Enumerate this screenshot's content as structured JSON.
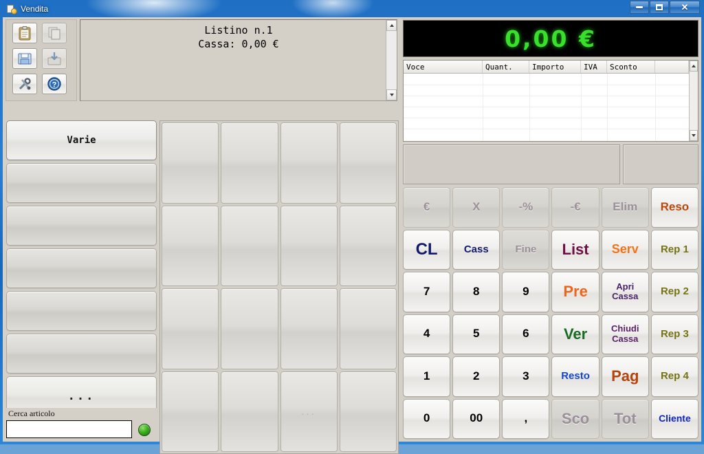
{
  "window": {
    "title": "Vendita",
    "icon": "app-page-coin-icon",
    "controls": {
      "minimize": "–",
      "maximize": "❑",
      "close": "✕"
    }
  },
  "toolbar": {
    "buttons": [
      {
        "name": "clipboard",
        "icon": "clipboard-icon",
        "enabled": true
      },
      {
        "name": "copy",
        "icon": "copy-documents-icon",
        "enabled": false
      },
      {
        "name": "save",
        "icon": "save-disk-icon",
        "enabled": true
      },
      {
        "name": "load",
        "icon": "load-import-icon",
        "enabled": false
      },
      {
        "name": "tools",
        "icon": "tools-wrench-screwdriver-icon",
        "enabled": true
      },
      {
        "name": "help",
        "icon": "help-question-icon",
        "enabled": true
      }
    ]
  },
  "listino": {
    "line1": "Listino n.1",
    "line2": "Cassa: 0,00 €"
  },
  "categories": {
    "items": [
      {
        "label": "Varie",
        "active": true
      },
      {
        "label": "",
        "active": false
      },
      {
        "label": "",
        "active": false
      },
      {
        "label": "",
        "active": false
      },
      {
        "label": "",
        "active": false
      },
      {
        "label": "",
        "active": false
      },
      {
        "label": "...",
        "active": false
      }
    ]
  },
  "search": {
    "label": "Cerca articolo",
    "value": "",
    "placeholder": "",
    "status_led_color": "#3fae22"
  },
  "product_grid": {
    "rows": 4,
    "columns": 4,
    "cells": [
      "",
      "",
      "",
      "",
      "",
      "",
      "",
      "",
      "",
      "",
      "",
      "",
      "",
      "",
      "...",
      ""
    ]
  },
  "display": {
    "total": "0,00 €",
    "color": "#37e02a",
    "background": "#000000"
  },
  "cart": {
    "columns": [
      "Voce",
      "Quant.",
      "Importo",
      "IVA",
      "Sconto",
      ""
    ],
    "rows": []
  },
  "keypad": {
    "rows": [
      [
        {
          "label": "€",
          "color": "#8d7f90",
          "enabled": false
        },
        {
          "label": "X",
          "color": "#8d7f90",
          "enabled": false
        },
        {
          "label": "-%",
          "color": "#8d7f90",
          "enabled": false
        },
        {
          "label": "-€",
          "color": "#8d7f90",
          "enabled": false
        },
        {
          "label": "Elim",
          "color": "#8d7f90",
          "enabled": false
        },
        {
          "label": "Reso",
          "color": "#b9480d",
          "enabled": true
        }
      ],
      [
        {
          "label": "CL",
          "color": "#111a6b",
          "enabled": true,
          "size": "24px"
        },
        {
          "label": "Cass",
          "color": "#111a6b",
          "enabled": true,
          "size": "15px"
        },
        {
          "label": "Fine",
          "color": "#8d8fa0",
          "enabled": false,
          "size": "15px"
        },
        {
          "label": "List",
          "color": "#6d1046",
          "enabled": true,
          "size": "22px"
        },
        {
          "label": "Serv",
          "color": "#f2741a",
          "enabled": true,
          "size": "18px"
        },
        {
          "label": "Rep 1",
          "color": "#757313",
          "enabled": true,
          "size": "15px"
        }
      ],
      [
        {
          "label": "7",
          "color": "#000000",
          "enabled": true
        },
        {
          "label": "8",
          "color": "#000000",
          "enabled": true
        },
        {
          "label": "9",
          "color": "#000000",
          "enabled": true
        },
        {
          "label": "Pre",
          "color": "#f2641a",
          "enabled": true,
          "size": "22px"
        },
        {
          "label": "Apri\nCassa",
          "color": "#4a2468",
          "enabled": true,
          "size": "13px"
        },
        {
          "label": "Rep 2",
          "color": "#757313",
          "enabled": true,
          "size": "15px"
        }
      ],
      [
        {
          "label": "4",
          "color": "#000000",
          "enabled": true
        },
        {
          "label": "5",
          "color": "#000000",
          "enabled": true
        },
        {
          "label": "6",
          "color": "#000000",
          "enabled": true
        },
        {
          "label": "Ver",
          "color": "#176b22",
          "enabled": true,
          "size": "22px"
        },
        {
          "label": "Chiudi\nCassa",
          "color": "#5a2168",
          "enabled": true,
          "size": "13px"
        },
        {
          "label": "Rep 3",
          "color": "#757313",
          "enabled": true,
          "size": "15px"
        }
      ],
      [
        {
          "label": "1",
          "color": "#000000",
          "enabled": true
        },
        {
          "label": "2",
          "color": "#000000",
          "enabled": true
        },
        {
          "label": "3",
          "color": "#000000",
          "enabled": true
        },
        {
          "label": "Resto",
          "color": "#1246d4",
          "enabled": true,
          "size": "15px"
        },
        {
          "label": "Pag",
          "color": "#b4430c",
          "enabled": true,
          "size": "22px"
        },
        {
          "label": "Rep 4",
          "color": "#757313",
          "enabled": true,
          "size": "15px"
        }
      ],
      [
        {
          "label": "0",
          "color": "#000000",
          "enabled": true
        },
        {
          "label": "00",
          "color": "#000000",
          "enabled": true
        },
        {
          "label": ",",
          "color": "#000000",
          "enabled": true
        },
        {
          "label": "Sco",
          "color": "#9a8284",
          "enabled": false,
          "size": "22px"
        },
        {
          "label": "Tot",
          "color": "#9a8284",
          "enabled": false,
          "size": "22px"
        },
        {
          "label": "Cliente",
          "color": "#1026c9",
          "enabled": true,
          "size": "14px"
        }
      ]
    ]
  }
}
